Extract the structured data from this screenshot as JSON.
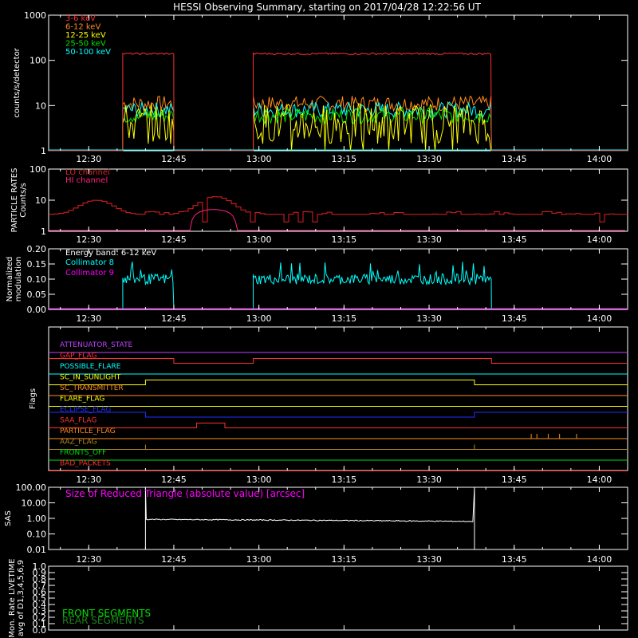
{
  "title": "HESSI Observing Summary, starting on 2017/04/28 12:22:56 UT",
  "time_ticks": [
    "12:30",
    "12:45",
    "13:00",
    "13:15",
    "13:30",
    "13:45",
    "14:00"
  ],
  "colors": {
    "background": "#000000",
    "axis": "#ffffff",
    "band_3_6": "#ff3030",
    "band_6_12": "#ff8c1a",
    "band_12_25": "#ffff00",
    "band_25_50": "#00e000",
    "band_50_100": "#00ffff",
    "lo_channel": "#e02020",
    "hi_channel": "#ff2080",
    "collimator_8": "#00ffff",
    "collimator_9": "#ff00ff"
  },
  "chart_data": [
    {
      "id": "count-rates",
      "type": "line",
      "ylabel": "counts/s/detector",
      "yscale": "log",
      "ylim": [
        1,
        1000
      ],
      "yticks": [
        "1",
        "10",
        "100",
        "1000"
      ],
      "legend": [
        "3-6 keV",
        "6-12 keV",
        "12-25 keV",
        "25-50 keV",
        "50-100 keV"
      ],
      "legend_placement": "top-left",
      "observing_intervals": [
        [
          "12:36",
          "12:45"
        ],
        [
          "12:59",
          "13:41"
        ]
      ],
      "series": [
        {
          "name": "3-6 keV",
          "level": 140
        },
        {
          "name": "6-12 keV",
          "level": 11
        },
        {
          "name": "12-25 keV",
          "level": 4
        },
        {
          "name": "25-50 keV",
          "level": 6
        },
        {
          "name": "50-100 keV",
          "level": 8
        }
      ]
    },
    {
      "id": "particle-rates",
      "type": "line",
      "ylabel": [
        "PARTICLE RATES",
        "Counts/s"
      ],
      "yscale": "log",
      "ylim": [
        1,
        100
      ],
      "yticks": [
        "1",
        "10",
        "100"
      ],
      "legend": [
        "LO channel",
        "HI channel"
      ],
      "series": [
        {
          "name": "LO channel",
          "baseline": 3.5,
          "bumps": [
            {
              "t": "12:31",
              "peak": 10
            },
            {
              "t": "12:52",
              "peak": 13
            }
          ]
        },
        {
          "name": "HI channel",
          "baseline": 1,
          "bumps": [
            {
              "t": "12:52",
              "peak": 5
            }
          ]
        }
      ]
    },
    {
      "id": "modulation",
      "type": "line",
      "ylabel": [
        "Normalized",
        "modulation"
      ],
      "ylim": [
        0,
        0.2
      ],
      "yticks": [
        "0.00",
        "0.05",
        "0.10",
        "0.15",
        "0.20"
      ],
      "legend": [
        "Energy band: 6-12 keV",
        "Collimator 8",
        "Collimator 9"
      ],
      "series": [
        {
          "name": "Collimator 8",
          "level": 0.1,
          "intervals": [
            [
              "12:36",
              "12:45"
            ],
            [
              "12:59",
              "13:41"
            ]
          ]
        },
        {
          "name": "Collimator 9",
          "level": 0.0
        }
      ]
    },
    {
      "id": "flags",
      "type": "line",
      "ylabel": "Flags",
      "flags": [
        {
          "name": "ATTENUATOR_STATE",
          "color": "#c040ff",
          "steps": []
        },
        {
          "name": "GAP_FLAG",
          "color": "#ff3030",
          "steps": [
            [
              "12:22:56",
              1
            ],
            [
              "12:45",
              0
            ],
            [
              "12:59",
              1
            ],
            [
              "13:41",
              0
            ]
          ]
        },
        {
          "name": "POSSIBLE_FLARE",
          "color": "#00ffff",
          "steps": []
        },
        {
          "name": "SC_IN_SUNLIGHT",
          "color": "#ffff00",
          "steps": [
            [
              "12:22:56",
              0
            ],
            [
              "12:40",
              1
            ],
            [
              "13:38",
              0
            ]
          ]
        },
        {
          "name": "SC_TRANSMITTER",
          "color": "#ff8c1a",
          "steps": []
        },
        {
          "name": "FLARE_FLAG",
          "color": "#ffff00",
          "steps": []
        },
        {
          "name": "ECLIPSE_FLAG",
          "color": "#2030ff",
          "steps": [
            [
              "12:22:56",
              1
            ],
            [
              "12:40",
              0
            ],
            [
              "13:38",
              1
            ]
          ]
        },
        {
          "name": "SAA_FLAG",
          "color": "#ff3030",
          "steps": [
            [
              "12:22:56",
              0
            ],
            [
              "12:49",
              1
            ],
            [
              "12:54",
              0
            ]
          ]
        },
        {
          "name": "PARTICLE_FLAG",
          "color": "#ff8c1a",
          "spikes": [
            "13:48",
            "13:49",
            "13:51",
            "13:53",
            "13:56"
          ]
        },
        {
          "name": "AAZ_FLAG",
          "color": "#b08a20",
          "spikes": [
            "12:40",
            "13:38"
          ]
        },
        {
          "name": "FRONTS_OFF",
          "color": "#00e000",
          "steps": []
        },
        {
          "name": "BAD_PACKETS",
          "color": "#ff3030",
          "steps": []
        }
      ]
    },
    {
      "id": "sas",
      "type": "line",
      "ylabel": "SAS",
      "yscale": "log",
      "ylim": [
        0.01,
        100
      ],
      "yticks": [
        "0.01",
        "0.10",
        "1.00",
        "10.00",
        "100.00"
      ],
      "annotation": "Size of Reduced Triangle (absolute value) [arcsec]",
      "series": [
        {
          "level": 0.75,
          "interval": [
            "12:40",
            "13:38"
          ]
        }
      ]
    },
    {
      "id": "livetime",
      "type": "line",
      "ylabel": [
        "Mon. Rate LIVETIME",
        "avg of D1,3,4,5,6,9"
      ],
      "ylim": [
        0,
        1
      ],
      "yticks": [
        "0.0",
        "0.1",
        "0.2",
        "0.3",
        "0.4",
        "0.5",
        "0.6",
        "0.7",
        "0.8",
        "0.9",
        "1.0"
      ],
      "legend": [
        "FRONT SEGMENTS",
        "REAR SEGMENTS"
      ],
      "series": []
    }
  ]
}
